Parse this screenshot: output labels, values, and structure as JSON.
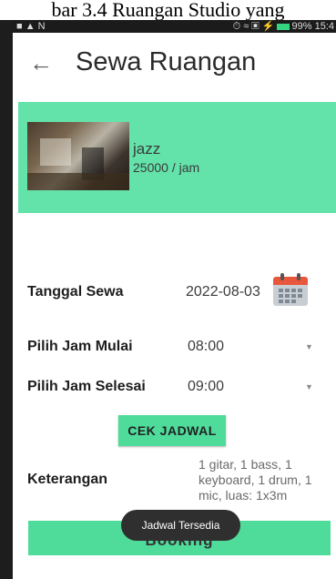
{
  "caption": "bar 3.4 Ruangan Studio yang",
  "status_bar": {
    "left_icons": "■ ▲ N",
    "right_icons": "⏱ ≈ ▣ ⚡",
    "battery": "99%",
    "time": "15:4"
  },
  "header": {
    "title": "Sewa Ruangan",
    "back_icon": "arrow-left-icon"
  },
  "room": {
    "name": "jazz",
    "price": "25000 / jam"
  },
  "form": {
    "date_label": "Tanggal Sewa",
    "date_value": "2022-08-03",
    "start_label": "Pilih Jam Mulai",
    "start_value": "08:00",
    "end_label": "Pilih Jam Selesai",
    "end_value": "09:00",
    "check_button": "CEK JADWAL",
    "notes_label": "Keterangan",
    "notes_value": "1 gitar, 1 bass, 1 keyboard, 1 drum, 1 mic, luas: 1x3m"
  },
  "booking_button": "Booking",
  "toast": "Jadwal Tersedia",
  "colors": {
    "accent": "#63e2aa",
    "button": "#4fdc9a",
    "toast": "#2f2f2f",
    "calendar_red": "#e8573c"
  }
}
